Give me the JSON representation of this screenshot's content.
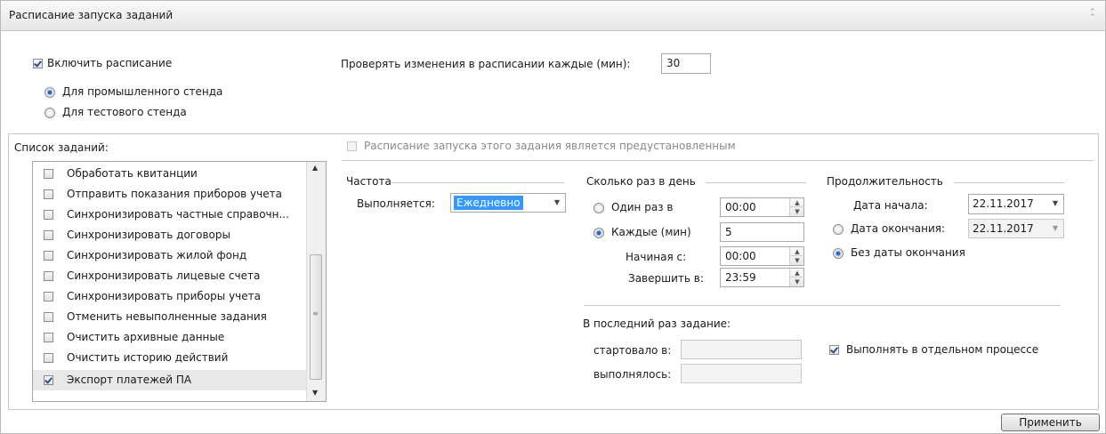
{
  "header": {
    "title": "Расписание запуска заданий"
  },
  "schedule": {
    "enable_label": "Включить расписание",
    "enable_checked": true,
    "env_options": [
      {
        "label": "Для промышленного стенда",
        "selected": true
      },
      {
        "label": "Для тестового стенда",
        "selected": false
      }
    ],
    "check_label": "Проверять изменения в расписании каждые (мин):",
    "check_value": "30"
  },
  "tasks": {
    "label": "Список заданий:",
    "items": [
      {
        "label": "Обработать квитанции",
        "checked": false
      },
      {
        "label": "Отправить показания приборов учета",
        "checked": false
      },
      {
        "label": "Синхронизировать частные справочн...",
        "checked": false
      },
      {
        "label": "Синхронизировать договоры",
        "checked": false
      },
      {
        "label": "Синхронизировать жилой фонд",
        "checked": false
      },
      {
        "label": "Синхронизировать лицевые счета",
        "checked": false
      },
      {
        "label": "Синхронизировать приборы учета",
        "checked": false
      },
      {
        "label": "Отменить невыполненные задания",
        "checked": false
      },
      {
        "label": "Очистить архивные данные",
        "checked": false
      },
      {
        "label": "Очистить историю действий",
        "checked": false
      },
      {
        "label": "Экспорт платежей ПА",
        "checked": true,
        "selected": true
      }
    ]
  },
  "preset": {
    "label": "Расписание запуска этого задания является предустановленным"
  },
  "frequency": {
    "group_label": "Частота",
    "runs_label": "Выполняется:",
    "runs_value": "Ежедневно"
  },
  "per_day": {
    "group_label": "Сколько раз в день",
    "once_label": "Один раз в",
    "once_value": "00:00",
    "every_label": "Каждые (мин)",
    "every_value": "5",
    "start_label": "Начиная с:",
    "start_value": "00:00",
    "end_label": "Завершить в:",
    "end_value": "23:59"
  },
  "duration": {
    "group_label": "Продолжительность",
    "start_date_label": "Дата начала:",
    "start_date_value": "22.11.2017",
    "end_date_label": "Дата окончания:",
    "end_date_value": "22.11.2017",
    "no_end_label": "Без даты окончания"
  },
  "last_run": {
    "label": "В последний раз задание:",
    "started_label": "стартовало в:",
    "finished_label": "выполнялось:",
    "separate_process_label": "Выполнять в отдельном процессе",
    "separate_process_checked": true
  },
  "footer": {
    "apply_label": "Применить"
  },
  "colors": {
    "accent": "#3399ff",
    "radio_dot": "#2e63c4",
    "check_mark": "#2b4d9a"
  }
}
